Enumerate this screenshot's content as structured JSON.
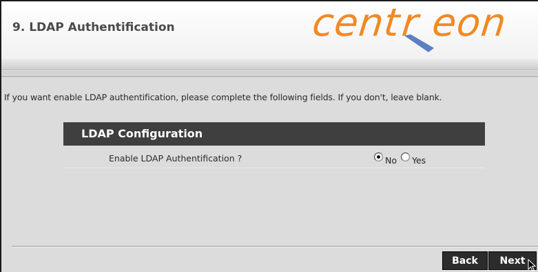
{
  "header": {
    "title": "9. LDAP Authentification",
    "logo_text": "centreon",
    "logo_color": "#f08a24",
    "logo_accent": "#5b7fc4"
  },
  "intro_text": "If you want enable LDAP authentification, please complete the following fields. If you don't, leave blank.",
  "config": {
    "heading": "LDAP Configuration",
    "rows": [
      {
        "label": "Enable LDAP Authentification ?",
        "options": [
          {
            "label": "No",
            "checked": true
          },
          {
            "label": "Yes",
            "checked": false
          }
        ]
      }
    ]
  },
  "footer": {
    "back_label": "Back",
    "next_label": "Next"
  }
}
